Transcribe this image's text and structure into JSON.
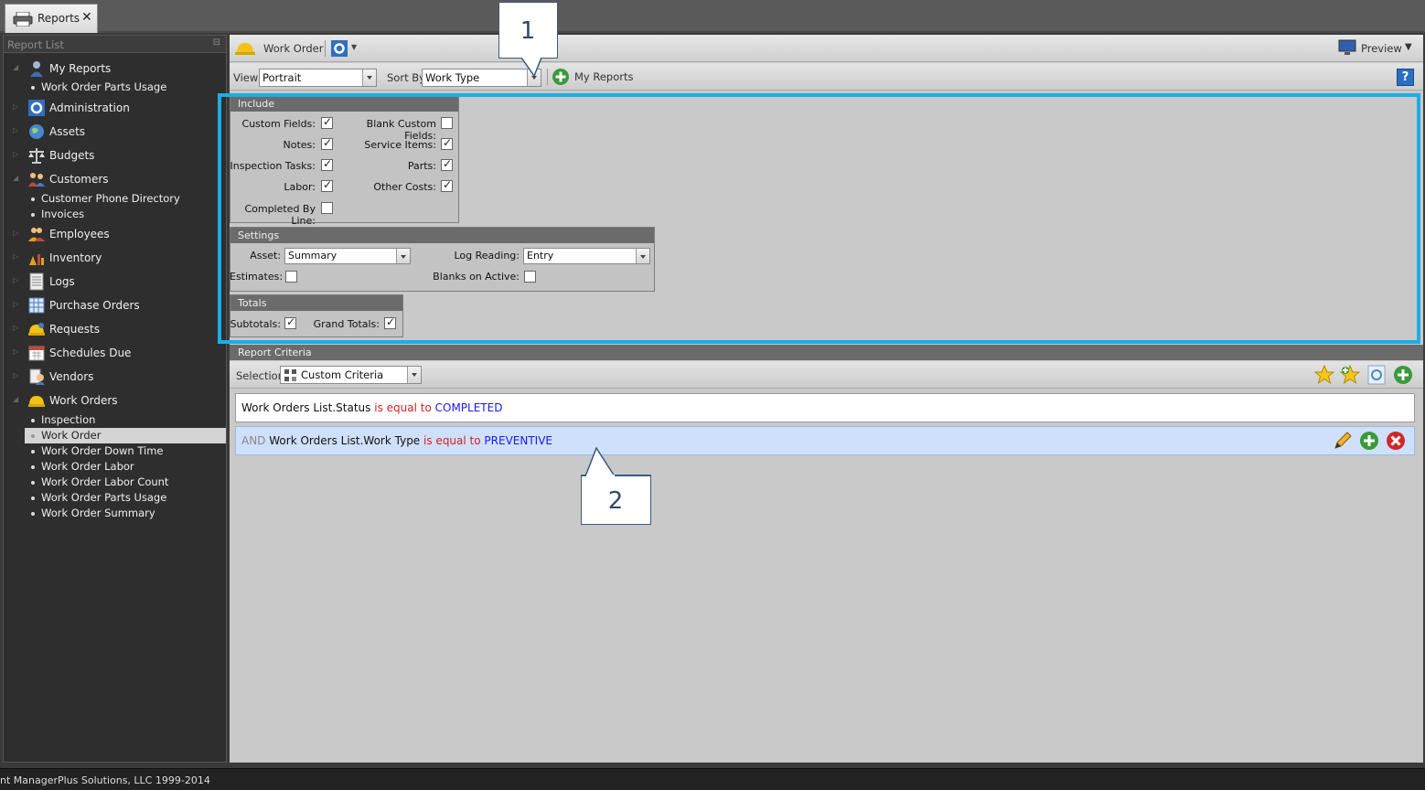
{
  "tab": {
    "label": "Reports",
    "close": "✕"
  },
  "sidebar": {
    "title": "Report List",
    "pin": "⊟",
    "my_reports": {
      "label": "My Reports",
      "items": [
        "Work Order Parts Usage"
      ]
    },
    "administration": "Administration",
    "assets": "Assets",
    "budgets": "Budgets",
    "customers": {
      "label": "Customers",
      "items": [
        "Customer Phone Directory",
        "Invoices"
      ]
    },
    "employees": "Employees",
    "inventory": "Inventory",
    "logs": "Logs",
    "purchase_orders": "Purchase Orders",
    "requests": "Requests",
    "schedules_due": "Schedules Due",
    "vendors": "Vendors",
    "work_orders": {
      "label": "Work Orders",
      "items": [
        "Inspection",
        "Work Order",
        "Work Order Down Time",
        "Work Order Labor",
        "Work Order Labor Count",
        "Work Order Parts Usage",
        "Work Order Summary"
      ],
      "selected_index": 1
    }
  },
  "toolbar": {
    "title": "Work Order",
    "preview": "Preview",
    "view_label": "View",
    "view_value": "Portrait",
    "sortby_label": "Sort By",
    "sortby_value": "Work Type",
    "my_reports": "My Reports",
    "help": "?"
  },
  "include": {
    "title": "Include",
    "custom_fields": {
      "label": "Custom Fields:",
      "checked": true
    },
    "blank_custom_fields": {
      "label": "Blank Custom Fields:",
      "checked": false
    },
    "notes": {
      "label": "Notes:",
      "checked": true
    },
    "service_items": {
      "label": "Service Items:",
      "checked": true
    },
    "inspection_tasks": {
      "label": "Inspection Tasks:",
      "checked": true
    },
    "parts": {
      "label": "Parts:",
      "checked": true
    },
    "labor": {
      "label": "Labor:",
      "checked": true
    },
    "other_costs": {
      "label": "Other Costs:",
      "checked": true
    },
    "completed_by_line": {
      "label": "Completed By Line:",
      "checked": false
    }
  },
  "settings": {
    "title": "Settings",
    "asset_label": "Asset:",
    "asset_value": "Summary",
    "log_reading_label": "Log Reading:",
    "log_reading_value": "Entry",
    "estimates": {
      "label": "Estimates:",
      "checked": false
    },
    "blanks_on_active": {
      "label": "Blanks on Active:",
      "checked": false
    }
  },
  "totals": {
    "title": "Totals",
    "subtotals": {
      "label": "Subtotals:",
      "checked": true
    },
    "grand_totals": {
      "label": "Grand Totals:",
      "checked": true
    }
  },
  "criteria": {
    "title": "Report Criteria",
    "selection_label": "Selection",
    "selection_value": "Custom Criteria",
    "rows": [
      {
        "conj": "",
        "field": "Work Orders List.Status",
        "op": "is equal to",
        "value": "COMPLETED"
      },
      {
        "conj": "AND",
        "field": "Work Orders List.Work Type",
        "op": "is equal to",
        "value": "PREVENTIVE"
      }
    ]
  },
  "callouts": {
    "one": "1",
    "two": "2"
  },
  "status": "nt ManagerPlus Solutions, LLC 1999-2014",
  "colors": {
    "highlight": "#1aaee6",
    "selected_row": "#cfe0fb",
    "op_red": "#d42020",
    "value_blue": "#1a1aee"
  }
}
